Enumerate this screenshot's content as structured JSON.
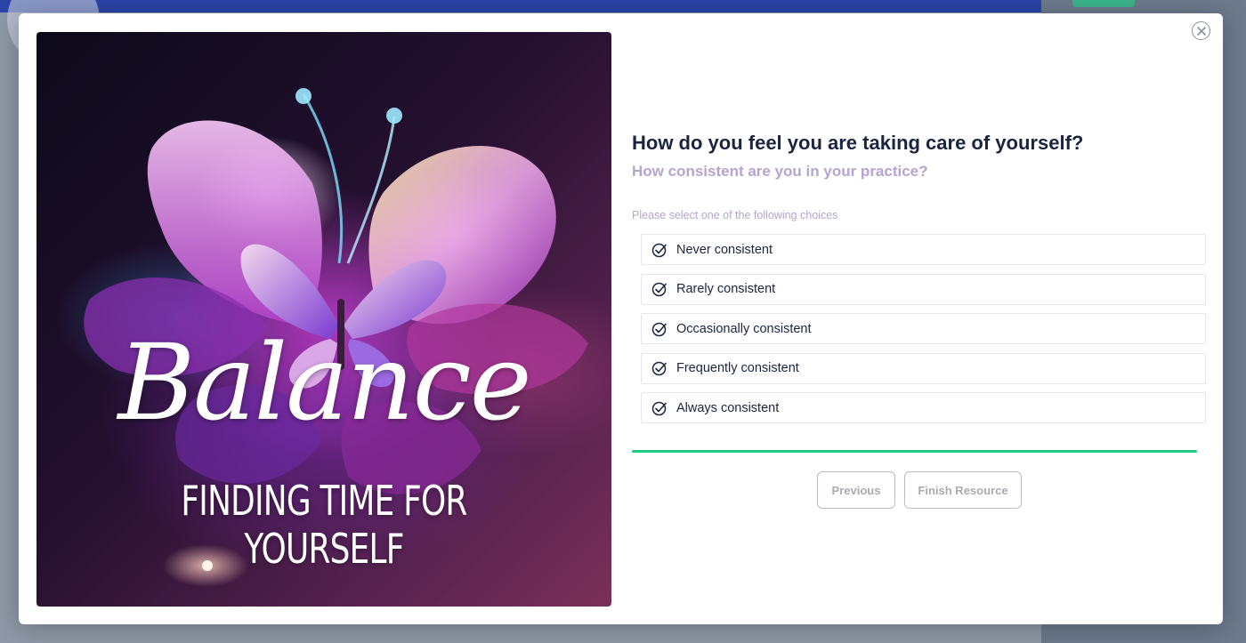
{
  "colors": {
    "accent": "#1ecb7f",
    "heading": "#1b2540",
    "muted": "#b5a4cf"
  },
  "close": {
    "icon": "close-icon"
  },
  "artwork": {
    "title": "Balance",
    "subtitle": "FINDING TIME FOR YOURSELF",
    "icon": "butterfly-flower-illustration"
  },
  "question": {
    "title": "How do you feel you are taking care of yourself?",
    "subtitle": "How consistent are you in your practice?",
    "instruction": "Please select one of the following choices"
  },
  "choices": [
    {
      "label": "Never consistent",
      "icon": "check-circle-icon"
    },
    {
      "label": "Rarely consistent",
      "icon": "check-circle-icon"
    },
    {
      "label": "Occasionally consistent",
      "icon": "check-circle-icon"
    },
    {
      "label": "Frequently consistent",
      "icon": "check-circle-icon"
    },
    {
      "label": "Always consistent",
      "icon": "check-circle-icon"
    }
  ],
  "progress": {
    "percent": 100
  },
  "buttons": {
    "previous": "Previous",
    "finish": "Finish Resource"
  }
}
